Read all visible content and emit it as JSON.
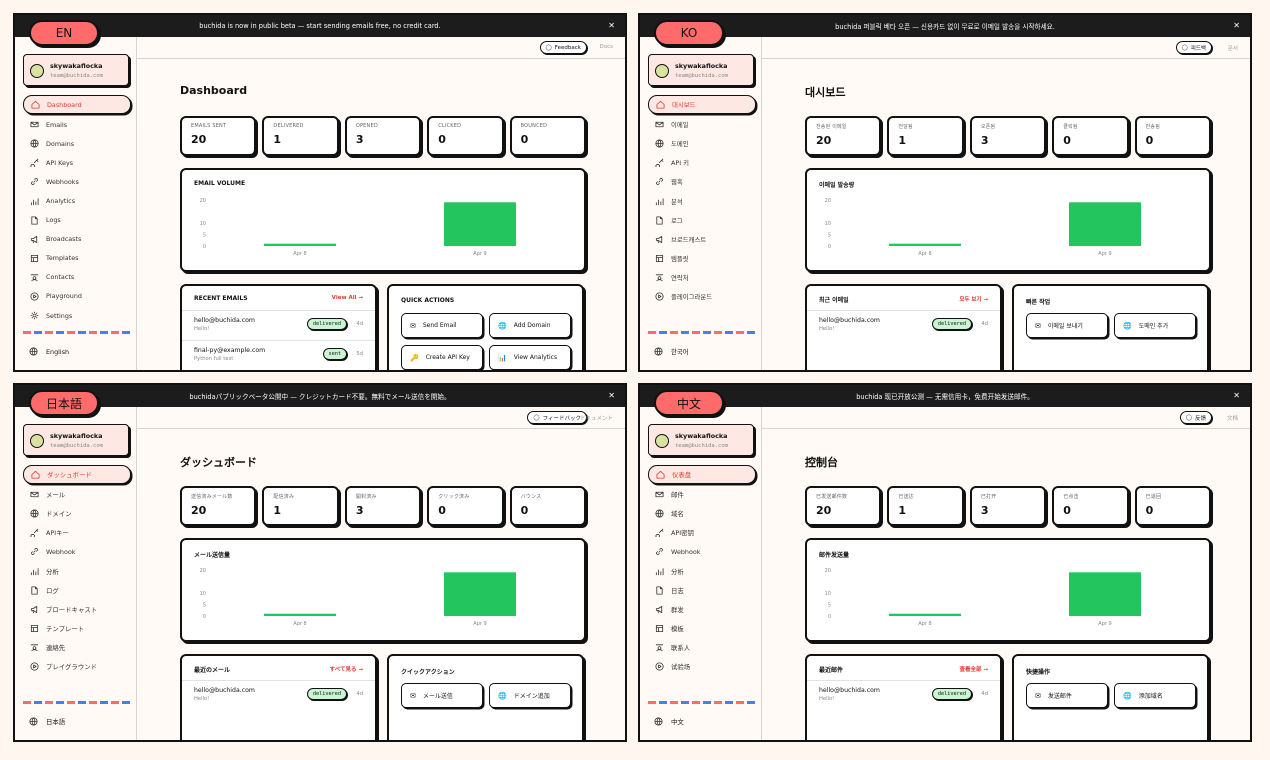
{
  "panels": [
    {
      "lang": "EN",
      "banner": "buchida is now in public beta — start sending emails free, no credit card.",
      "user": {
        "name": "skywakaflocka",
        "email": "team@buchida.com"
      },
      "nav": [
        "Dashboard",
        "Emails",
        "Domains",
        "API Keys",
        "Webhooks",
        "Analytics",
        "Logs",
        "Broadcasts",
        "Templates",
        "Contacts",
        "Playground",
        "Settings"
      ],
      "language": "English",
      "feedback": "Feedback",
      "docs": "Docs",
      "title": "Dashboard",
      "stats": [
        {
          "label": "EMAILS SENT",
          "value": "20"
        },
        {
          "label": "DELIVERED",
          "value": "1"
        },
        {
          "label": "OPENED",
          "value": "3"
        },
        {
          "label": "CLICKED",
          "value": "0"
        },
        {
          "label": "BOUNCED",
          "value": "0"
        }
      ],
      "volume_title": "EMAIL VOLUME",
      "recent_title": "RECENT EMAILS",
      "view_all": "View All →",
      "emails": [
        {
          "to": "hello@buchida.com",
          "subject": "Hello!",
          "status": "delivered",
          "age": "4d"
        },
        {
          "to": "final-py@example.com",
          "subject": "Python full test",
          "status": "sent",
          "age": "5d"
        }
      ],
      "quick_title": "QUICK ACTIONS",
      "actions": [
        "Send Email",
        "Add Domain",
        "Create API Key",
        "View Analytics"
      ]
    },
    {
      "lang": "KO",
      "banner": "buchida 퍼블릭 베타 오픈 — 신용카드 없이 무료로 이메일 발송을 시작하세요.",
      "user": {
        "name": "skywakaflocka",
        "email": "team@buchida.com"
      },
      "nav": [
        "대시보드",
        "이메일",
        "도메인",
        "API 키",
        "웹훅",
        "분석",
        "로그",
        "브로드캐스트",
        "템플릿",
        "연락처",
        "플레이그라운드"
      ],
      "language": "한국어",
      "feedback": "피드백",
      "docs": "문서",
      "title": "대시보드",
      "stats": [
        {
          "label": "전송된 이메일",
          "value": "20"
        },
        {
          "label": "전달됨",
          "value": "1"
        },
        {
          "label": "오픈됨",
          "value": "3"
        },
        {
          "label": "클릭됨",
          "value": "0"
        },
        {
          "label": "반송됨",
          "value": "0"
        }
      ],
      "volume_title": "이메일 발송량",
      "recent_title": "최근 이메일",
      "view_all": "모두 보기 →",
      "emails": [
        {
          "to": "hello@buchida.com",
          "subject": "Hello!",
          "status": "delivered",
          "age": "4d"
        }
      ],
      "quick_title": "빠른 작업",
      "actions": [
        "이메일 보내기",
        "도메인 추가"
      ]
    },
    {
      "lang": "日本語",
      "banner": "buchidaパブリックベータ公開中 — クレジットカード不要。無料でメール送信を開始。",
      "user": {
        "name": "skywakaflocka",
        "email": "team@buchida.com"
      },
      "nav": [
        "ダッシュボード",
        "メール",
        "ドメイン",
        "APIキー",
        "Webhook",
        "分析",
        "ログ",
        "ブロードキャスト",
        "テンプレート",
        "連絡先",
        "プレイグラウンド"
      ],
      "language": "日本語",
      "feedback": "フィードバック",
      "docs": "ドキュメント",
      "title": "ダッシュボード",
      "stats": [
        {
          "label": "送信済みメール数",
          "value": "20"
        },
        {
          "label": "配信済み",
          "value": "1"
        },
        {
          "label": "開封済み",
          "value": "3"
        },
        {
          "label": "クリック済み",
          "value": "0"
        },
        {
          "label": "バウンス",
          "value": "0"
        }
      ],
      "volume_title": "メール送信量",
      "recent_title": "最近のメール",
      "view_all": "すべて見る →",
      "emails": [
        {
          "to": "hello@buchida.com",
          "subject": "Hello!",
          "status": "delivered",
          "age": "4d"
        }
      ],
      "quick_title": "クイックアクション",
      "actions": [
        "メール送信",
        "ドメイン追加"
      ]
    },
    {
      "lang": "中文",
      "banner": "buchida 现已开放公测 — 无需信用卡，免费开始发送邮件。",
      "user": {
        "name": "skywakaflocka",
        "email": "team@buchida.com"
      },
      "nav": [
        "仪表盘",
        "邮件",
        "域名",
        "API密钥",
        "Webhook",
        "分析",
        "日志",
        "群发",
        "模板",
        "联系人",
        "试验场"
      ],
      "language": "中文",
      "feedback": "反馈",
      "docs": "文档",
      "title": "控制台",
      "stats": [
        {
          "label": "已发送邮件数",
          "value": "20"
        },
        {
          "label": "已送达",
          "value": "1"
        },
        {
          "label": "已打开",
          "value": "3"
        },
        {
          "label": "已点击",
          "value": "0"
        },
        {
          "label": "已退回",
          "value": "0"
        }
      ],
      "volume_title": "邮件发送量",
      "recent_title": "最近邮件",
      "view_all": "查看全部 →",
      "emails": [
        {
          "to": "hello@buchida.com",
          "subject": "Hello!",
          "status": "delivered",
          "age": "4d"
        }
      ],
      "quick_title": "快捷操作",
      "actions": [
        "发送邮件",
        "添加域名"
      ]
    }
  ],
  "chart_data": {
    "type": "bar",
    "categories": [
      "Apr 8",
      "Apr 9"
    ],
    "values": [
      1,
      19
    ],
    "yticks": [
      0,
      5,
      10,
      20
    ],
    "ylim": [
      0,
      20
    ],
    "color": "#22c55e"
  },
  "colors": {
    "accent": "#ff6b6b",
    "link": "#e03a2e",
    "bar": "#22c55e",
    "badge": "#c9f5d3",
    "banner": "#1c1c1c"
  },
  "nav_icons": [
    "home-icon",
    "mail-icon",
    "globe-icon",
    "key-icon",
    "link-icon",
    "bar-chart-icon",
    "file-icon",
    "megaphone-icon",
    "template-icon",
    "contacts-icon",
    "play-icon",
    "settings-icon"
  ],
  "action_icons": [
    "✉",
    "🌐",
    "🔑",
    "📊"
  ]
}
